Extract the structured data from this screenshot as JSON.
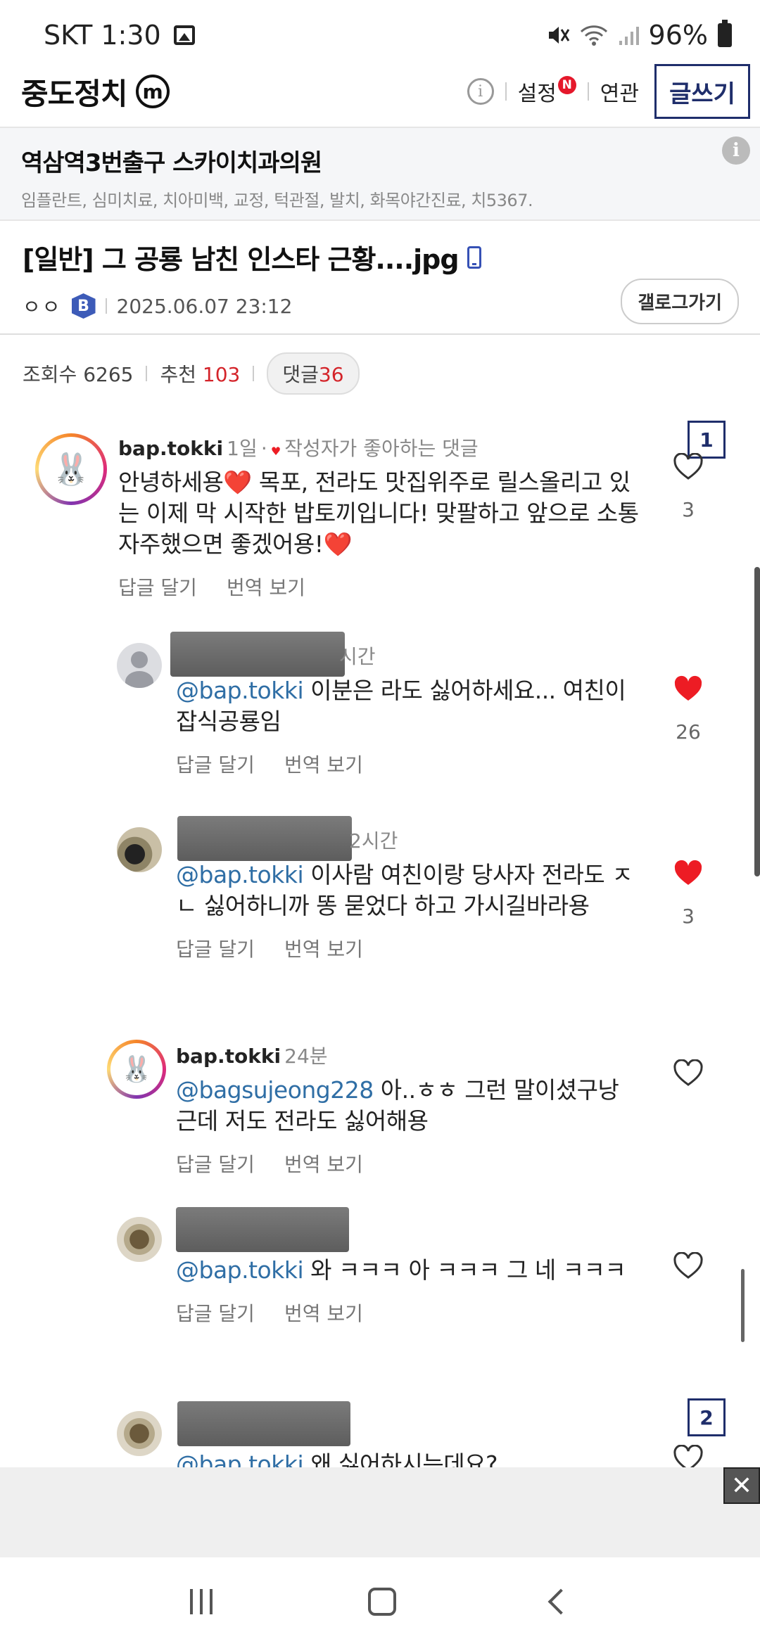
{
  "status_bar": {
    "carrier_time": "SKT 1:30",
    "battery": "96%",
    "icons": [
      "gallery-icon",
      "mute-icon",
      "wifi-icon",
      "signal-icon",
      "battery-icon"
    ]
  },
  "app_header": {
    "brand": "중도정치",
    "brand_badge": "m",
    "info_symbol": "i",
    "settings_label": "설정",
    "new_badge": "N",
    "related_label": "연관",
    "write_label": "글쓰기"
  },
  "ad": {
    "title": "역삼역3번출구 스카이치과의원",
    "description": "임플란트, 심미치료, 치아미백, 교정, 턱관절, 발치, 화목야간진료, 치5367.",
    "info_symbol": "i"
  },
  "post": {
    "title": "[일반] 그 공룡 남친 인스타 근황....jpg",
    "author": "ㅇㅇ",
    "author_badge": "B",
    "datetime": "2025.06.07 23:12",
    "gallery_button": "갤로그가기"
  },
  "stats": {
    "views_label": "조회수",
    "views": "6265",
    "recommend_label": "추천",
    "recommend": "103",
    "comments_label": "댓글",
    "comments": "36"
  },
  "markers": [
    "1",
    "2"
  ],
  "comments": [
    {
      "user": "bap.tokki",
      "time": "1일",
      "separator": "·",
      "pinned_note": "작성자가 좋아하는 댓글",
      "text": "안녕하세용❤️ 목포, 전라도 맛집위주로 릴스올리고 있는 이제 막 시작한 밥토끼입니다! 맞팔하고 앞으로 소통 자주했으면 좋겠어용!❤️",
      "reply_label": "답글 달기",
      "translate_label": "번역 보기",
      "likes": "3",
      "liked": false
    },
    {
      "time": "시간",
      "mention": "@bap.tokki",
      "text": "이분은 라도 싫어하세요... 여친이 잡식공룡임",
      "reply_label": "답글 달기",
      "translate_label": "번역 보기",
      "likes": "26",
      "liked": true
    },
    {
      "time": "2시간",
      "mention": "@bap.tokki",
      "text": "이사람 여친이랑 당사자 전라도 ㅈㄴ 싫어하니까 똥 묻었다 하고 가시길바라용",
      "reply_label": "답글 달기",
      "translate_label": "번역 보기",
      "likes": "3",
      "liked": true
    },
    {
      "user": "bap.tokki",
      "time": "24분",
      "mention": "@bagsujeong228",
      "text": "아..ㅎㅎ 그런 말이셨구낭 근데 저도 전라도 싫어해용",
      "reply_label": "답글 달기",
      "translate_label": "번역 보기",
      "liked": false
    },
    {
      "mention": "@bap.tokki",
      "text": "와 ㅋㅋㅋ 아 ㅋㅋㅋ 그 네 ㅋㅋㅋ",
      "reply_label": "답글 달기",
      "translate_label": "번역 보기",
      "liked": false
    },
    {
      "mention": "@bap.tokki",
      "text": "왜 싫어하시는데요?",
      "liked": false
    }
  ],
  "colors": {
    "brand_navy": "#1f2e6b",
    "accent_red": "#d4242a",
    "mention_blue": "#2f6ea5",
    "heart_red": "#ed1c24"
  },
  "bottom_ad": {
    "close_symbol": "✕"
  }
}
